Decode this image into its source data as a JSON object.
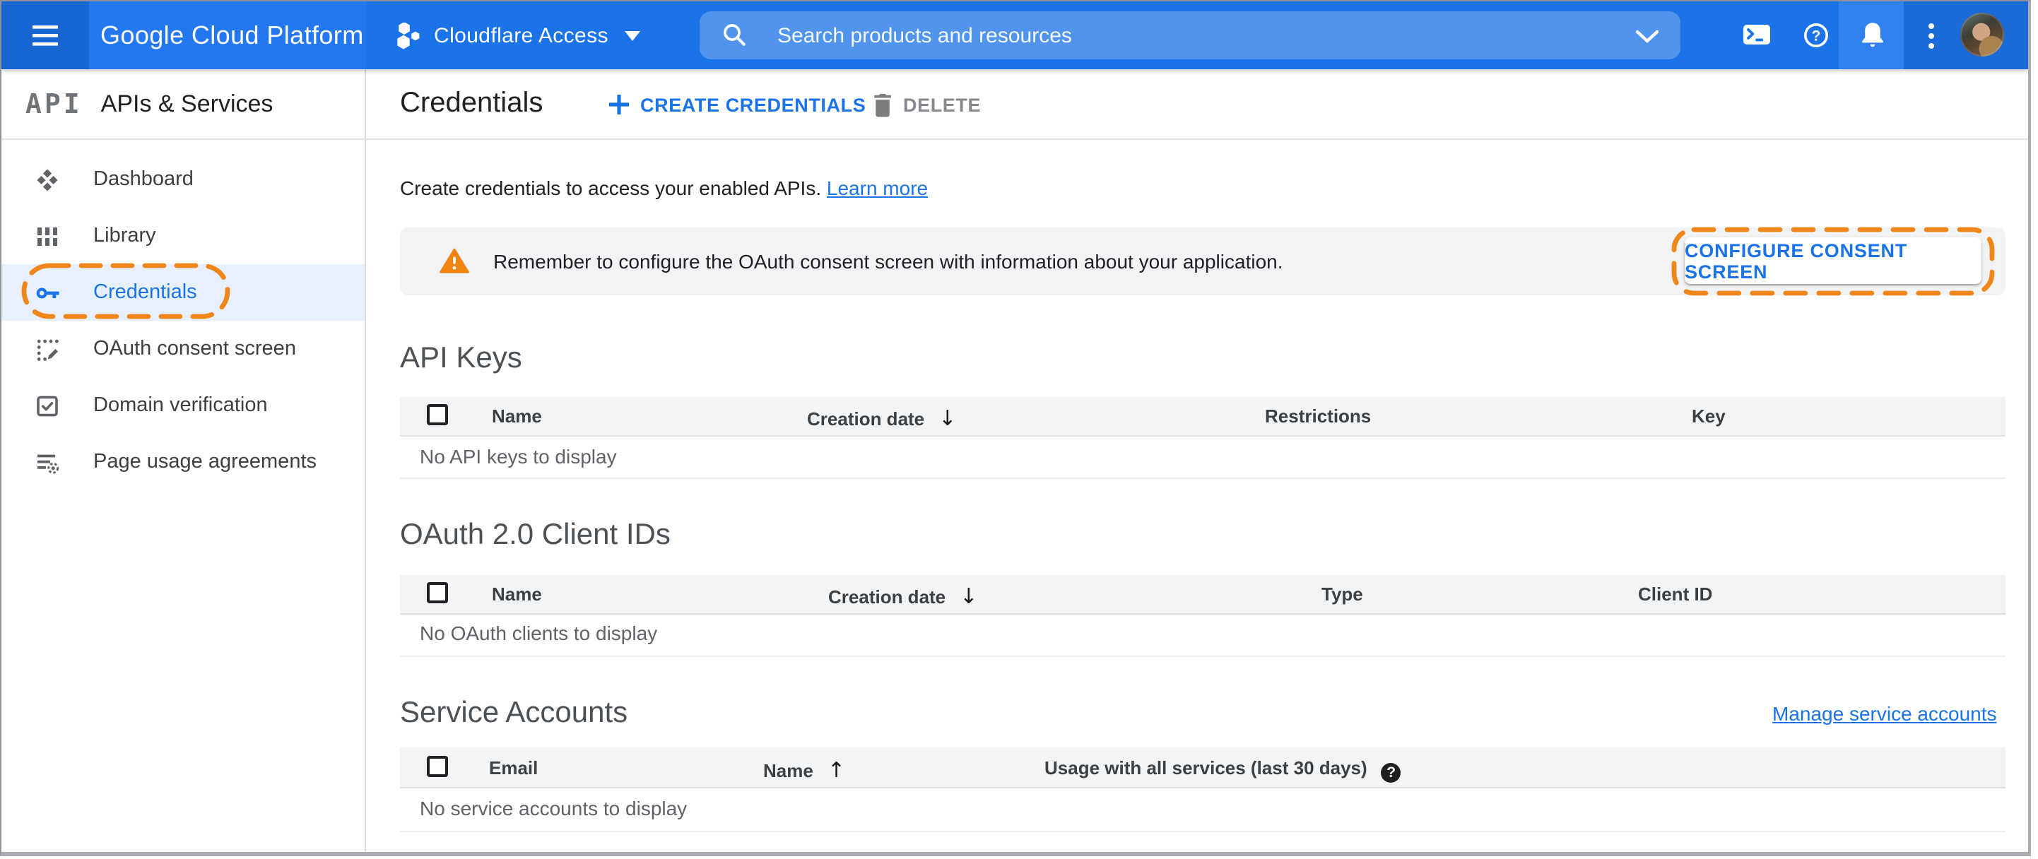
{
  "topbar": {
    "logo_text": "Google Cloud Platform",
    "project_name": "Cloudflare Access",
    "search_placeholder": "Search products and resources",
    "icons": [
      "hamburger-icon",
      "project-hexagons-icon",
      "project-caret-icon",
      "search-icon",
      "search-dropdown-chevron-icon",
      "cloud-shell-icon",
      "help-icon",
      "notifications-bell-icon",
      "more-options-icon",
      "avatar"
    ]
  },
  "sidebar": {
    "product_initials": "API",
    "product_name": "APIs & Services",
    "items": [
      {
        "label": "Dashboard",
        "icon": "dashboard-icon",
        "selected": false
      },
      {
        "label": "Library",
        "icon": "library-icon",
        "selected": false
      },
      {
        "label": "Credentials",
        "icon": "key-icon",
        "selected": true,
        "annotated": true
      },
      {
        "label": "OAuth consent screen",
        "icon": "consent-screen-icon",
        "selected": false
      },
      {
        "label": "Domain verification",
        "icon": "domain-verification-icon",
        "selected": false
      },
      {
        "label": "Page usage agreements",
        "icon": "page-usage-icon",
        "selected": false
      }
    ]
  },
  "header": {
    "title": "Credentials",
    "create_button": "CREATE CREDENTIALS",
    "delete_button": "DELETE"
  },
  "intro": {
    "text": "Create credentials to access your enabled APIs.",
    "link": "Learn more"
  },
  "banner": {
    "message": "Remember to configure the OAuth consent screen with information about your application.",
    "action": "CONFIGURE CONSENT SCREEN"
  },
  "sections": {
    "api_keys": {
      "heading": "API Keys",
      "columns": {
        "name": "Name",
        "creation_date": "Creation date",
        "restrictions": "Restrictions",
        "key": "Key"
      },
      "sort_arrow": "↓",
      "empty": "No API keys to display"
    },
    "oauth_clients": {
      "heading": "OAuth 2.0 Client IDs",
      "columns": {
        "name": "Name",
        "creation_date": "Creation date",
        "type": "Type",
        "client_id": "Client ID"
      },
      "sort_arrow": "↓",
      "empty": "No OAuth clients to display"
    },
    "service_accounts": {
      "heading": "Service Accounts",
      "manage_link": "Manage service accounts",
      "columns": {
        "email": "Email",
        "name": "Name",
        "usage": "Usage with all services (last 30 days)"
      },
      "sort_arrow": "↑",
      "help_glyph": "?",
      "empty": "No service accounts to display"
    }
  },
  "colors": {
    "topbar_blue": "#1a73e8",
    "accent_blue": "#1a73e8",
    "annotation_orange": "#f0861a",
    "warning_orange": "#ef8410",
    "selected_item_bg": "#e8f0fe",
    "banner_bg": "#f1f3f4",
    "table_header_bg": "#f3f4f5"
  }
}
